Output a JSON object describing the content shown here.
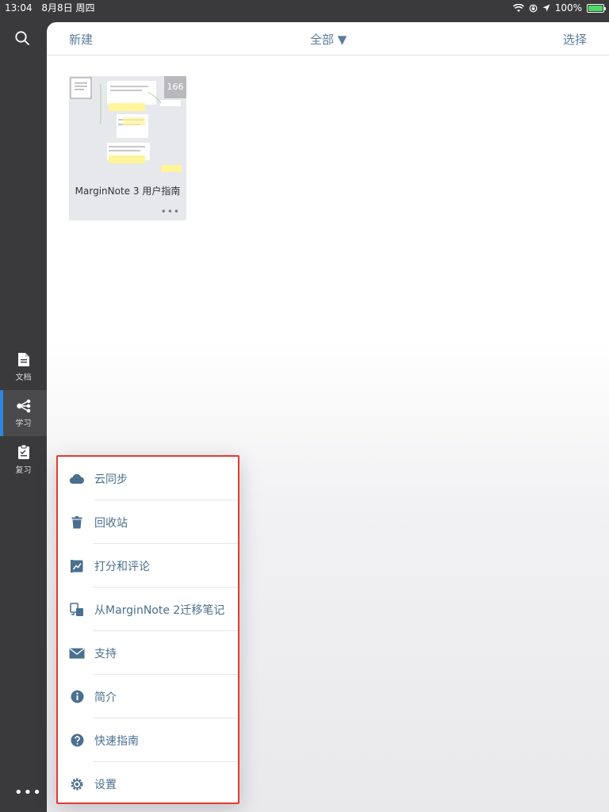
{
  "status_bar": {
    "time": "13:04",
    "date": "8月8日 周四",
    "battery": "100%"
  },
  "sidebar": {
    "items": [
      {
        "label": "文档",
        "icon": "document-icon"
      },
      {
        "label": "学习",
        "icon": "mindmap-icon"
      },
      {
        "label": "复习",
        "icon": "review-clipboard-icon"
      }
    ],
    "active": "学习",
    "more": "•••"
  },
  "header": {
    "new_label": "新建",
    "filter_label": "全部 ▼",
    "select_label": "选择"
  },
  "document": {
    "title": "MarginNote 3 用户指南",
    "page_count": "166",
    "more": "•••"
  },
  "menu": {
    "items": [
      {
        "label": "云同步",
        "icon": "cloud-icon"
      },
      {
        "label": "回收站",
        "icon": "trash-icon"
      },
      {
        "label": "打分和评论",
        "icon": "rating-chart-icon"
      },
      {
        "label": "从MarginNote 2迁移笔记",
        "icon": "migrate-icon"
      },
      {
        "label": "支持",
        "icon": "mail-icon"
      },
      {
        "label": "简介",
        "icon": "info-icon"
      },
      {
        "label": "快速指南",
        "icon": "help-icon"
      },
      {
        "label": "设置",
        "icon": "gear-icon"
      }
    ]
  },
  "colors": {
    "accent": "#5b7c99",
    "menu_text": "#4a6f8f",
    "highlight_border": "#e53935",
    "sidebar_bg": "#3a3a3c",
    "active_indicator": "#2e86de"
  }
}
